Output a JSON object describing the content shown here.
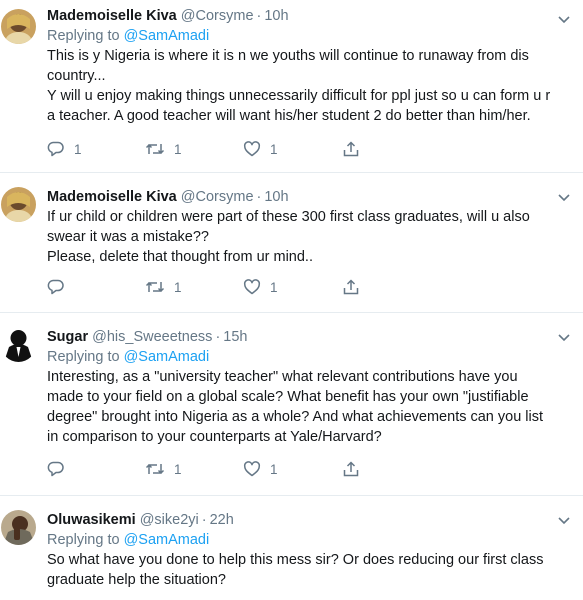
{
  "tweets": [
    {
      "name": "Mademoiselle Kiva",
      "handle": "@Corsyme",
      "time": "10h",
      "reply_prefix": "Replying to",
      "reply_to": "@SamAmadi",
      "lines": [
        "This is y Nigeria is where it is n we youths will continue to runaway from dis",
        "country...",
        "Y will u enjoy making things unnecessarily difficult for ppl just so u can form u r",
        "a teacher. A good teacher will want his/her student 2 do better than him/her."
      ],
      "replies": "1",
      "retweets": "1",
      "likes": "1"
    },
    {
      "name": "Mademoiselle Kiva",
      "handle": "@Corsyme",
      "time": "10h",
      "lines": [
        "If ur child or children were part of these 300 first class graduates, will u also",
        "swear it was a mistake??",
        "Please, delete that thought from ur mind.."
      ],
      "replies": "",
      "retweets": "1",
      "likes": "1"
    },
    {
      "name": "Sugar",
      "handle": "@his_Sweeetness",
      "time": "15h",
      "reply_prefix": "Replying to",
      "reply_to": "@SamAmadi",
      "lines": [
        "Interesting, as a \"university teacher\" what relevant contributions have you",
        "made to your field on a global scale? What benefit has your own \"justifiable",
        "degree\" brought into Nigeria as a whole? And what achievements can you list",
        "in comparison to your counterparts at Yale/Harvard?"
      ],
      "replies": "",
      "retweets": "1",
      "likes": "1"
    },
    {
      "name": "Oluwasikemi",
      "handle": "@sike2yi",
      "time": "22h",
      "reply_prefix": "Replying to",
      "reply_to": "@SamAmadi",
      "lines": [
        "So what have you done to help this mess sir? Or does reducing our first class",
        "graduate help the situation?"
      ]
    }
  ],
  "colors": {
    "text": "#14171a",
    "muted": "#657786",
    "link": "#1da1f2",
    "divider": "#e6ecf0"
  },
  "icons": [
    "reply-icon",
    "retweet-icon",
    "like-icon",
    "share-icon",
    "caret-down-icon"
  ]
}
